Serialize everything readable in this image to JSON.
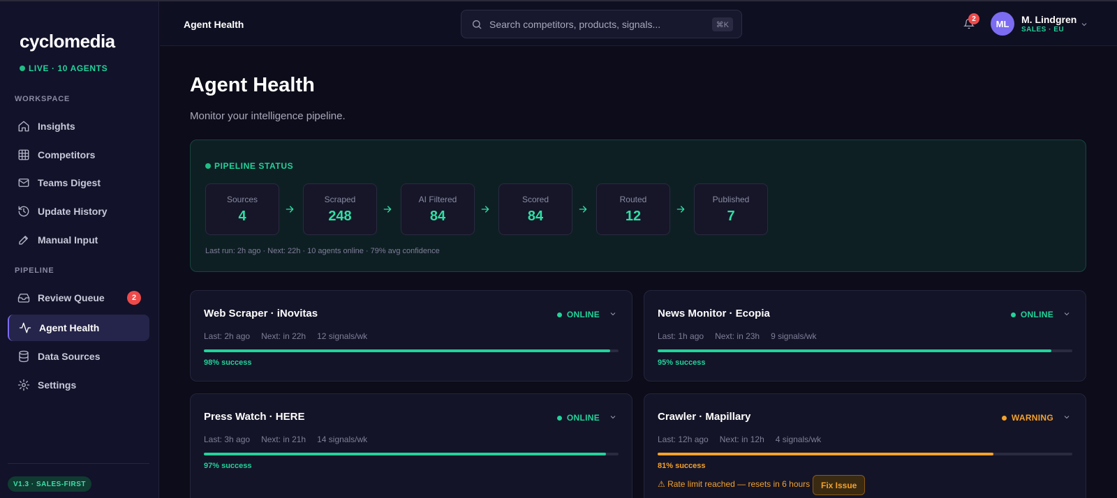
{
  "app": {
    "logo": "cyclomedia",
    "live_status": "LIVE · 10 AGENTS",
    "version": "V1.3 · SALES-FIRST"
  },
  "sidebar": {
    "workspace_label": "WORKSPACE",
    "pipeline_label": "PIPELINE",
    "workspace_items": [
      {
        "label": "Insights",
        "icon": "home-icon"
      },
      {
        "label": "Competitors",
        "icon": "grid-icon"
      },
      {
        "label": "Teams Digest",
        "icon": "mail-icon"
      },
      {
        "label": "Update History",
        "icon": "history-icon"
      },
      {
        "label": "Manual Input",
        "icon": "pen-icon"
      }
    ],
    "pipeline_items": [
      {
        "label": "Review Queue",
        "icon": "inbox-icon",
        "badge": "2"
      },
      {
        "label": "Agent Health",
        "icon": "activity-icon",
        "active": true
      },
      {
        "label": "Data Sources",
        "icon": "database-icon"
      },
      {
        "label": "Settings",
        "icon": "gear-icon"
      }
    ]
  },
  "header": {
    "title": "Agent Health",
    "search_placeholder": "Search competitors, products, signals...",
    "search_shortcut": "⌘K",
    "notification_count": "2",
    "user_initials": "ML",
    "user_name": "M. Lindgren",
    "user_role": "SALES · EU"
  },
  "page": {
    "title": "Agent Health",
    "subtitle": "Monitor your intelligence pipeline."
  },
  "pipeline": {
    "label": "PIPELINE STATUS",
    "stages": [
      {
        "label": "Sources",
        "value": "4"
      },
      {
        "label": "Scraped",
        "value": "248"
      },
      {
        "label": "AI Filtered",
        "value": "84"
      },
      {
        "label": "Scored",
        "value": "84"
      },
      {
        "label": "Routed",
        "value": "12"
      },
      {
        "label": "Published",
        "value": "7"
      }
    ],
    "footer": "Last run: 2h ago · Next: 22h · 10 agents online · 79% avg confidence"
  },
  "agents": [
    {
      "name": "Web Scraper · iNovitas",
      "status": "ONLINE",
      "last": "Last: 2h ago",
      "next": "Next: in 22h",
      "signals": "12 signals/wk",
      "success": "98% success",
      "success_pct": 98,
      "color": "#22d39a"
    },
    {
      "name": "News Monitor · Ecopia",
      "status": "ONLINE",
      "last": "Last: 1h ago",
      "next": "Next: in 23h",
      "signals": "9 signals/wk",
      "success": "95% success",
      "success_pct": 95,
      "color": "#22d39a"
    },
    {
      "name": "Press Watch · HERE",
      "status": "ONLINE",
      "last": "Last: 3h ago",
      "next": "Next: in 21h",
      "signals": "14 signals/wk",
      "success": "97% success",
      "success_pct": 97,
      "color": "#22d39a"
    },
    {
      "name": "Crawler · Mapillary",
      "status": "WARNING",
      "last": "Last: 12h ago",
      "next": "Next: in 12h",
      "signals": "4 signals/wk",
      "success": "81% success",
      "success_pct": 81,
      "color": "#f4a22a",
      "warning": "⚠ Rate limit reached — resets in 6 hours",
      "fix_label": "Fix Issue"
    }
  ],
  "colors": {
    "accent_green": "#22d39a",
    "accent_purple": "#7c6cf0",
    "warning": "#f4a22a",
    "badge_red": "#ef4a4a"
  }
}
